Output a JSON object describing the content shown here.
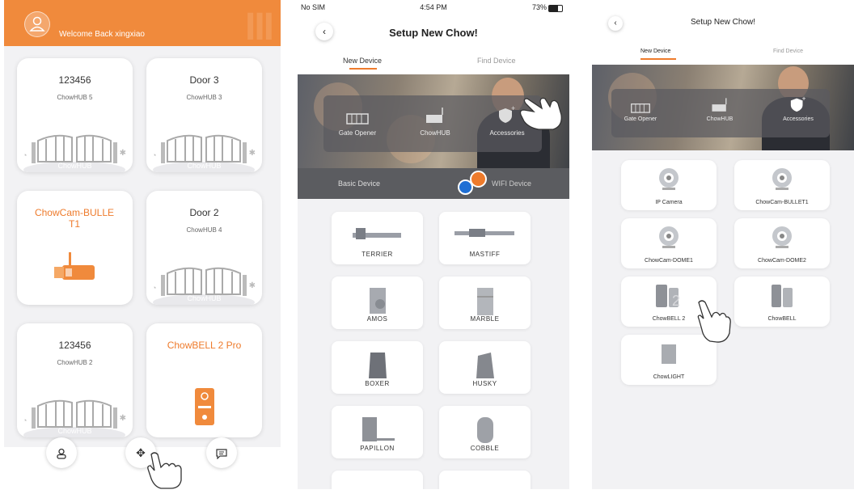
{
  "home": {
    "welcome": "Welcome Back xingxiao",
    "cards": [
      {
        "title": "123456",
        "subtitle": "ChowHUB 5",
        "gate_label": "ChowHUB"
      },
      {
        "title": "Door 3",
        "subtitle": "ChowHUB 3",
        "gate_label": "ChowHUB"
      },
      {
        "title": "ChowCam-BULLE T1",
        "subtitle": ""
      },
      {
        "title": "Door 2",
        "subtitle": "ChowHUB 4",
        "gate_label": "ChowHUB"
      },
      {
        "title": "123456",
        "subtitle": "ChowHUB 2",
        "gate_label": "ChowHUB"
      },
      {
        "title": "ChowBELL 2 Pro",
        "subtitle": ""
      }
    ],
    "nav": [
      {
        "icon": "user-icon"
      },
      {
        "icon": "add-icon"
      },
      {
        "icon": "message-icon"
      }
    ]
  },
  "setup": {
    "status": {
      "carrier": "No SIM",
      "time": "4:54 PM",
      "battery": "73%"
    },
    "title": "Setup New Chow!",
    "tabs": [
      "New Device",
      "Find Device"
    ],
    "categories": [
      "Gate Opener",
      "ChowHUB",
      "Accessories"
    ],
    "sub_tabs": [
      "Basic Device",
      "WIFI Device"
    ],
    "devices": [
      "TERRIER",
      "MASTIFF",
      "AMOS",
      "MARBLE",
      "BOXER",
      "HUSKY",
      "PAPILLON",
      "COBBLE"
    ]
  },
  "accessories": {
    "title": "Setup New Chow!",
    "tabs": [
      "New Device",
      "Find Device"
    ],
    "categories": [
      "Gate Opener",
      "ChowHUB",
      "Accessories"
    ],
    "items": [
      "IP Camera",
      "ChowCam-BULLET1",
      "ChowCam-DOME1",
      "ChowCam-DOME2",
      "ChowBELL 2",
      "ChowBELL",
      "ChowLIGHT"
    ]
  },
  "colors": {
    "accent": "#ee7b2c",
    "header": "#f08a3c",
    "dark_bar": "#5b5c60"
  }
}
